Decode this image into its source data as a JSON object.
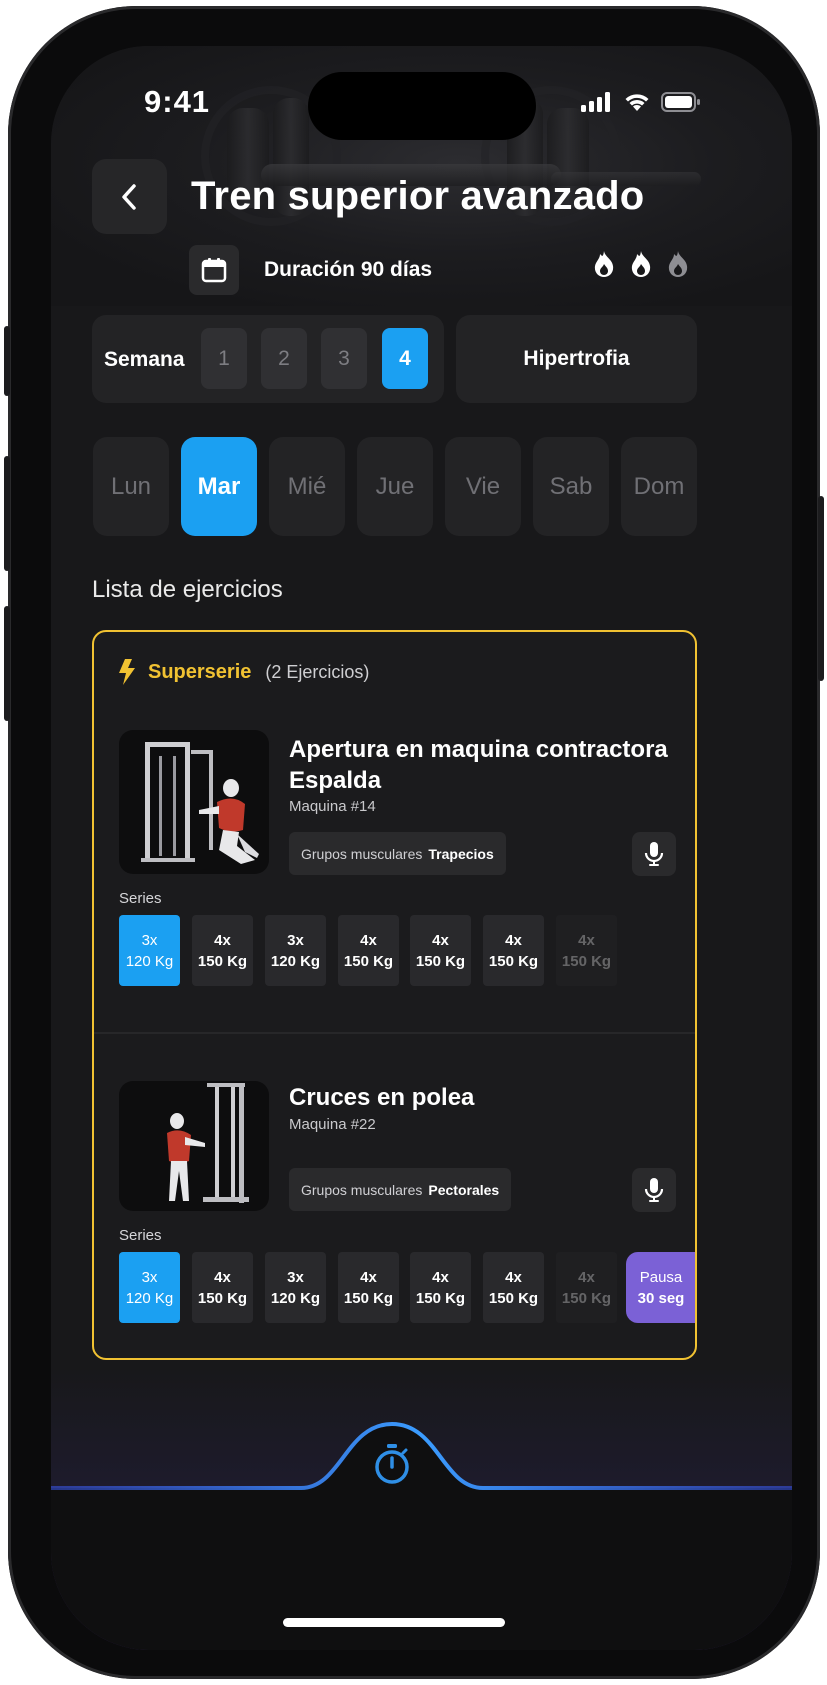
{
  "status_bar": {
    "time": "9:41"
  },
  "header": {
    "title": "Tren superior avanzado",
    "duration": "Duración 90 días"
  },
  "week": {
    "label": "Semana",
    "options": [
      "1",
      "2",
      "3",
      "4"
    ],
    "selected": "4",
    "goal": "Hipertrofia"
  },
  "days": {
    "items": [
      "Lun",
      "Mar",
      "Mié",
      "Jue",
      "Vie",
      "Sab",
      "Dom"
    ],
    "selected": "Mar"
  },
  "exercise_list": {
    "title": "Lista de ejercicios",
    "superserie": {
      "label": "Superserie",
      "count": "(2 Ejercicios)"
    },
    "exercises": [
      {
        "name": "Apertura en maquina contractora Espalda",
        "machine": "Maquina #14",
        "muscle_label": "Grupos musculares",
        "muscle": "Trapecios",
        "series_label": "Series",
        "sets": [
          {
            "reps": "3x",
            "weight": "120 Kg"
          },
          {
            "reps": "4x",
            "weight": "150 Kg"
          },
          {
            "reps": "3x",
            "weight": "120 Kg"
          },
          {
            "reps": "4x",
            "weight": "150 Kg"
          },
          {
            "reps": "4x",
            "weight": "150 Kg"
          },
          {
            "reps": "4x",
            "weight": "150 Kg"
          },
          {
            "reps": "4x",
            "weight": "150 Kg"
          }
        ]
      },
      {
        "name": "Cruces en polea",
        "machine": "Maquina #22",
        "muscle_label": "Grupos musculares",
        "muscle": "Pectorales",
        "series_label": "Series",
        "sets": [
          {
            "reps": "3x",
            "weight": "120 Kg"
          },
          {
            "reps": "4x",
            "weight": "150 Kg"
          },
          {
            "reps": "3x",
            "weight": "120 Kg"
          },
          {
            "reps": "4x",
            "weight": "150 Kg"
          },
          {
            "reps": "4x",
            "weight": "150 Kg"
          },
          {
            "reps": "4x",
            "weight": "150 Kg"
          },
          {
            "reps": "4x",
            "weight": "150 Kg"
          }
        ],
        "pause": {
          "label": "Pausa",
          "value": "30 seg"
        }
      }
    ]
  },
  "colors": {
    "accent": "#1ba0f2",
    "superserie": "#f1c232",
    "pause": "#7b61d6",
    "background": "#18181a"
  },
  "icons": [
    "back-arrow-icon",
    "calendar-icon",
    "flame-icon",
    "bolt-icon",
    "microphone-icon",
    "stopwatch-icon"
  ]
}
